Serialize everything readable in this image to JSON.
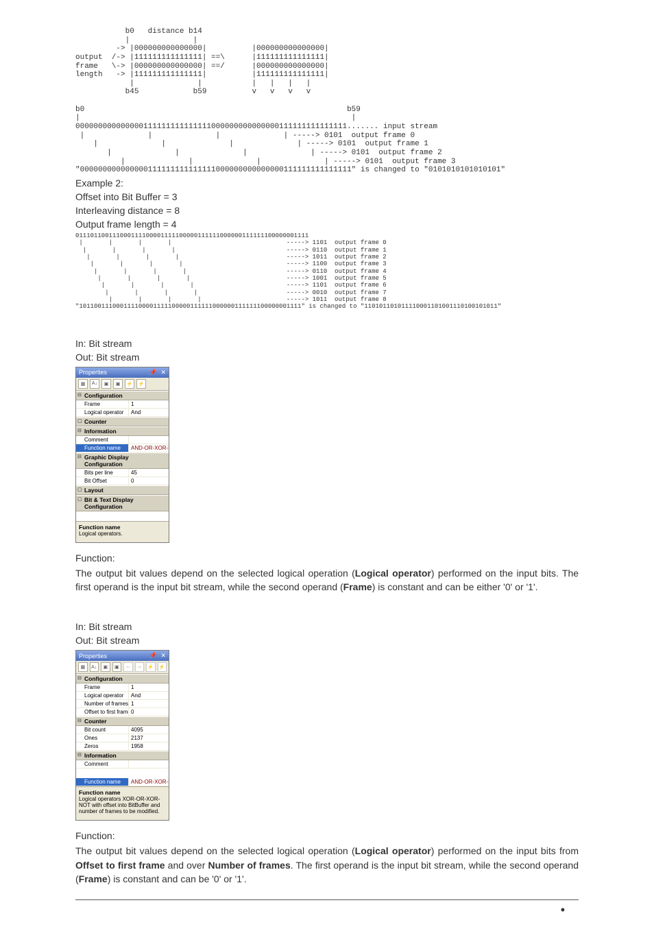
{
  "diagram1_ascii": "           b0   distance b14\n           |              |\n         -> |000000000000000|          |000000000000000|\noutput  /-> |111111111111111| ==\\      |111111111111111|\nframe   \\-> |000000000000000| ==/      |000000000000000|\nlength   -> |111111111111111|          |111111111111111|\n            |              |           |   |   |   |\n           b45            b59          v   v   v   v\n\nb0                                                          b59\n|                                                            |\n000000000000000111111111111111000000000000000111111111111111....... input stream\n |              |              |              | -----> 0101  output frame 0\n    |              |              |              | -----> 0101  output frame 1\n       |              |              |              | -----> 0101  output frame 2\n          |              |              |              | -----> 0101  output frame 3",
  "diagram1_footer": "\"000000000000000111111111111111000000000000000111111111111111\" is changed to \"0101010101010101\"",
  "example2_heading": "Example 2:",
  "example2_line1": "Offset into Bit Buffer = 3",
  "example2_line2": "Interleaving distance = 8",
  "example2_line3": "Output frame length = 4",
  "diagram2_ascii": "011101100111000111100001111100000111111000000111111100000001111\n |       |       |       |                               -----> 1101  output frame 0\n  |       |       |       |                              -----> 0110  output frame 1\n   |       |       |       |                             -----> 1011  output frame 2\n    |       |       |       |                            -----> 1100  output frame 3\n     |       |       |       |                           -----> 0110  output frame 4\n      |       |       |       |                          -----> 1001  output frame 5\n       |       |       |       |                         -----> 1101  output frame 6\n        |       |       |       |                        -----> 0010  output frame 7\n         |       |       |       |                       -----> 1011  output frame 8",
  "diagram2_footer": "\"101100111000111100001111100000111111000000111111100000001111\" is changed to \"110101101011110001101001110100101011\"",
  "io_in": "In: Bit stream",
  "io_out": "Out: Bit stream",
  "panel1": {
    "title": "Properties",
    "sections": {
      "config": "Configuration",
      "counter": "Counter",
      "info": "Information",
      "gdc": "Graphic Display Configuration",
      "layout": "Layout",
      "btdc": "Bit & Text Display Configuration"
    },
    "rows": {
      "frame_k": "Frame",
      "frame_v": "1",
      "logop_k": "Logical operator",
      "logop_v": "And",
      "comment_k": "Comment",
      "comment_v": "",
      "funcname_k": "Function name",
      "funcname_v": "AND-OR-XOR-NOT",
      "bpl_k": "Bits per line",
      "bpl_v": "45",
      "bo_k": "Bit Offset",
      "bo_v": "0"
    },
    "desc_title": "Function name",
    "desc_body": "Logical operators."
  },
  "func_label": "Function:",
  "func1_body_pre": "The output bit values depend on the selected logical operation (",
  "func1_b1": "Logical operator",
  "func1_mid1": ") performed on the input bits. The first operand is the input bit stream, while the second operand (",
  "func1_b2": "Frame",
  "func1_end": ") is constant and can be either '0' or '1'.",
  "panel2": {
    "title": "Properties",
    "sections": {
      "config": "Configuration",
      "counter": "Counter",
      "info": "Information"
    },
    "rows": {
      "frame_k": "Frame",
      "frame_v": "1",
      "logop_k": "Logical operator",
      "logop_v": "And",
      "nof_k": "Number of frames",
      "nof_v": "1",
      "otff_k": "Offset to first frame",
      "otff_v": "0",
      "bitc_k": "Bit count",
      "bitc_v": "4095",
      "ones_k": "Ones",
      "ones_v": "2137",
      "zeros_k": "Zeros",
      "zeros_v": "1958",
      "comment_k": "Comment",
      "comment_v": "",
      "funcname_k": "Function name",
      "funcname_v": "AND-OR-XOR-NOT"
    },
    "desc_title": "Function name",
    "desc_body": "Logical operators XOR-OR-XOR-NOT with offset into BitBuffer and number of frames to be modified."
  },
  "func2_pre": "The output bit values depend on the selected logical operation (",
  "func2_b1": "Logical operator",
  "func2_mid1": ") performed on the input bits from ",
  "func2_b2": "Offset to first frame",
  "func2_mid2": " and over ",
  "func2_b3": "Number of frames",
  "func2_mid3": ". The first operand is the input bit stream, while the second operand (",
  "func2_b4": "Frame",
  "func2_end": ") is constant and can be '0' or '1'."
}
